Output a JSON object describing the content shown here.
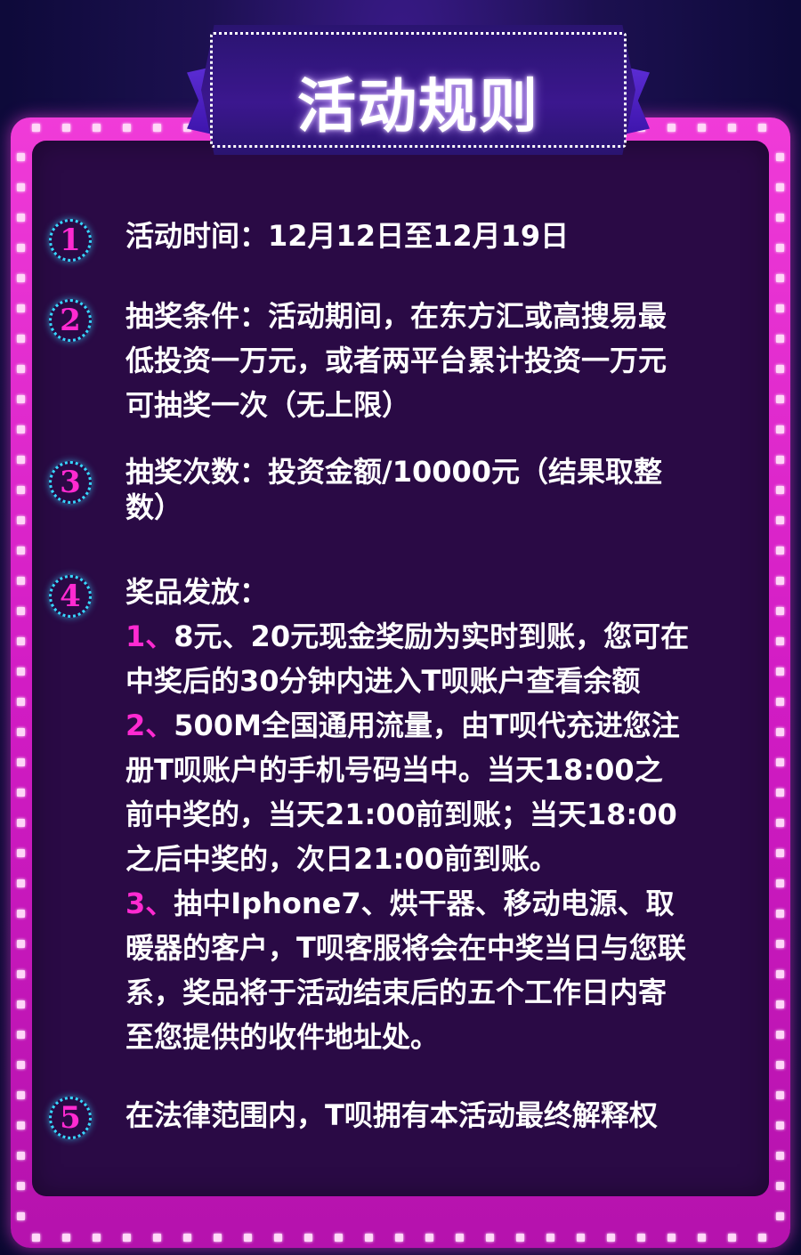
{
  "title": "活动规则",
  "colors": {
    "accent_pink": "#ff2ad1",
    "circle_border": "#37d7ff",
    "frame": "#d21cc4",
    "panel": "#2a0a45"
  },
  "rules": [
    {
      "num": "1",
      "text": "活动时间：12月12日至12月19日"
    },
    {
      "num": "2",
      "lines": [
        "抽奖条件：活动期间，在东方汇或高搜易最",
        "低投资一万元，或者两平台累计投资一万元",
        "可抽奖一次（无上限）"
      ]
    },
    {
      "num": "3",
      "lines": [
        "抽奖次数：投资金额/10000元（结果取整",
        "数）"
      ]
    },
    {
      "num": "4",
      "heading": "奖品发放：",
      "items": [
        {
          "idx": "1、",
          "lines": [
            "8元、20元现金奖励为实时到账，您可在",
            "中奖后的30分钟内进入T呗账户查看余额"
          ]
        },
        {
          "idx": "2、",
          "lines": [
            "500M全国通用流量，由T呗代充进您注",
            "册T呗账户的手机号码当中。当天18:00之",
            "前中奖的，当天21:00前到账；当天18:00",
            "之后中奖的，次日21:00前到账。"
          ]
        },
        {
          "idx": "3、",
          "lines": [
            "抽中Iphone7、烘干器、移动电源、取",
            "暖器的客户，T呗客服将会在中奖当日与您联",
            "系，奖品将于活动结束后的五个工作日内寄",
            "至您提供的收件地址处。"
          ]
        }
      ]
    },
    {
      "num": "5",
      "text": "在法律范围内，T呗拥有本活动最终解释权"
    }
  ]
}
